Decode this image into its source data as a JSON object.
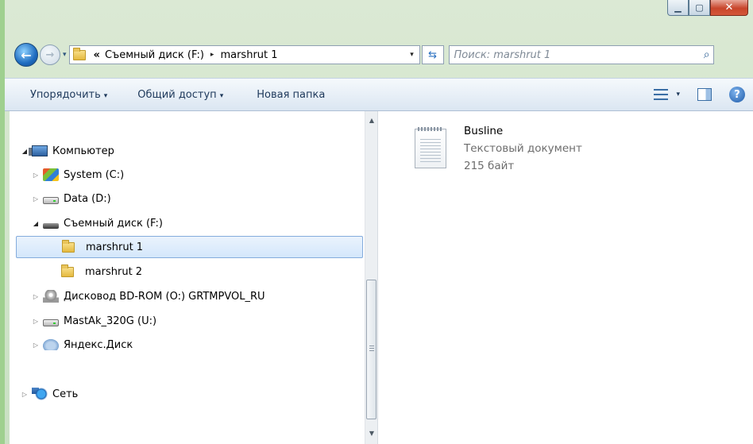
{
  "window": {
    "minimize_glyph": "▁",
    "maximize_glyph": "▢",
    "close_glyph": "✕"
  },
  "address_bar": {
    "overflow_glyph": "«",
    "crumbs": [
      "Съемный диск (F:)",
      "marshrut 1"
    ],
    "separator_glyph": "▸",
    "dropdown_glyph": "▾",
    "refresh_glyph": "⇆"
  },
  "search": {
    "placeholder": "Поиск: marshrut 1",
    "icon_glyph": "⌕"
  },
  "toolbar": {
    "organize": "Упорядочить",
    "share": "Общий доступ",
    "new_folder": "Новая папка",
    "dropdown_glyph": "▾",
    "help_glyph": "?"
  },
  "tree": {
    "computer": "Компьютер",
    "system": "System (C:)",
    "data": "Data (D:)",
    "removable": "Съемный диск (F:)",
    "folder1": "marshrut 1",
    "folder2": "marshrut 2",
    "bd_rom": "Дисковод BD-ROM (O:) GRTMPVOL_RU",
    "mastak": "MastAk_320G (U:)",
    "yandex": "Яндекс.Диск",
    "network": "Сеть",
    "collapsed_glyph": "▷",
    "expanded_glyph": "◢"
  },
  "scrollbar": {
    "up_glyph": "▲",
    "down_glyph": "▼"
  },
  "files": [
    {
      "name": "Busline",
      "type": "Текстовый документ",
      "size": "215 байт"
    }
  ],
  "colors": {
    "frame": "#c9e0c3",
    "toolbar": "#dbe6f2",
    "selection": "#d4e7fb",
    "text": "#1e395b"
  }
}
